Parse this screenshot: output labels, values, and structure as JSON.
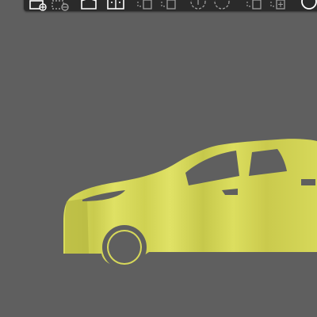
{
  "app": {
    "accent_color": "#d7d95a",
    "background_color": "#5f5f5f",
    "toolbar_color": "#2a2a2a"
  },
  "toolbar": {
    "icons": [
      "add-object-icon",
      "remove-object-icon",
      "view-front-icon",
      "view-split-icon",
      "split-left-icon",
      "split-right-icon",
      "rotate-left-icon",
      "rotate-right-icon",
      "mirror-left-icon",
      "mirror-right-icon",
      "settings-icon"
    ]
  },
  "model": {
    "name_icon": "car-model",
    "color": "#d7d95a",
    "shade_color": "#a8a83a"
  }
}
